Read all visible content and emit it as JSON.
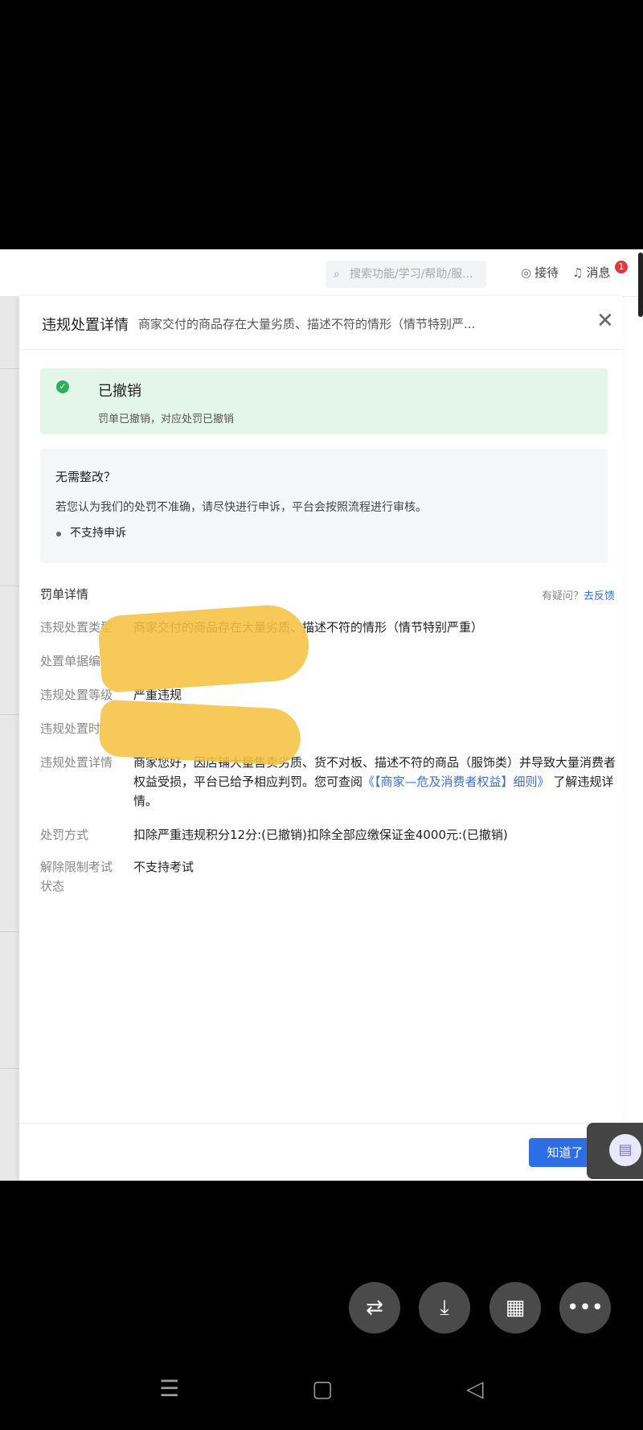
{
  "topbar": {
    "search_placeholder": "搜索功能/学习/帮助/服...",
    "service_label": "接待",
    "message_label": "消息",
    "message_badge": "1"
  },
  "dialog": {
    "title": "违规处置详情",
    "subtitle": "商家交付的商品存在大量劣质、描述不符的情形（情节特别严...",
    "status": {
      "title": "已撤销",
      "desc": "罚单已撤销，对应处罚已撤销"
    },
    "appeal": {
      "question": "无需整改？",
      "desc": "若您认为我们的处罚不准确，请尽快进行申诉，平台会按照流程进行审核。",
      "bullet": "不支持申诉"
    },
    "section_title": "罚单详情",
    "help_prefix": "有疑问？",
    "help_link": "去反馈",
    "rows": [
      {
        "label": "违规处置类型",
        "value": "商家交付的商品存在大量劣质、描述不符的情形（情节特别严重）"
      },
      {
        "label": "处置单据编",
        "value": ""
      },
      {
        "label": "违规处置等级",
        "value": "严重违规"
      },
      {
        "label": "违规处置时",
        "value": ""
      },
      {
        "label": "违规处置详情",
        "value_text": "商家您好，因店铺大量售卖劣质、货不对板、描述不符的商品（服饰类）并导致大量消费者权益受损，平台已给予相应判罚。您可查阅",
        "value_link": "《【商家—危及消费者权益】细则》",
        "value_suffix": "了解违规详情。"
      },
      {
        "label": "处罚方式",
        "value": "扣除严重违规积分12分:(已撤销)扣除全部应缴保证金4000元:(已撤销)"
      },
      {
        "label": "解除限制考试状态",
        "value": "不支持考试"
      }
    ],
    "ok_button": "知道了"
  },
  "colors": {
    "accent": "#2d6de6",
    "success_bg": "#e4f6ea",
    "success_icon": "#2eae5e",
    "badge": "#e23a3a",
    "link": "#3b6fd8",
    "redaction": "#f5c242"
  }
}
